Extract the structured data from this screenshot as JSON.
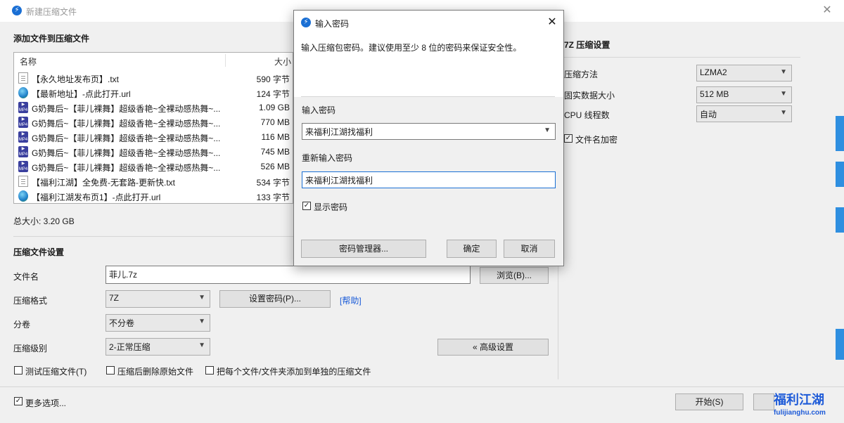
{
  "main": {
    "title": "新建压缩文件",
    "add_files_heading": "添加文件到压缩文件",
    "columns": {
      "name": "名称",
      "size": "大小"
    },
    "files": [
      {
        "name": "【永久地址发布页】.txt",
        "size": "590 字节",
        "icon": "txt-file-icon"
      },
      {
        "name": "【最新地址】-点此打开.url",
        "size": "124 字节",
        "icon": "url-file-icon"
      },
      {
        "name": "G奶舞后~【菲儿裸舞】超级香艳~全裸动感热舞~...",
        "size": "1.09 GB",
        "icon": "mp4-file-icon"
      },
      {
        "name": "G奶舞后~【菲儿裸舞】超级香艳~全裸动感热舞~...",
        "size": "770 MB",
        "icon": "mp4-file-icon"
      },
      {
        "name": "G奶舞后~【菲儿裸舞】超级香艳~全裸动感热舞~...",
        "size": "116 MB",
        "icon": "mp4-file-icon"
      },
      {
        "name": "G奶舞后~【菲儿裸舞】超级香艳~全裸动感热舞~...",
        "size": "745 MB",
        "icon": "mp4-file-icon"
      },
      {
        "name": "G奶舞后~【菲儿裸舞】超级香艳~全裸动感热舞~...",
        "size": "526 MB",
        "icon": "mp4-file-icon"
      },
      {
        "name": "【福利江湖】全免费-无套路-更新快.txt",
        "size": "534 字节",
        "icon": "txt-file-icon"
      },
      {
        "name": "【福利江湖发布页1】-点此打开.url",
        "size": "133 字节",
        "icon": "url-file-icon"
      }
    ],
    "total_size": "总大小: 3.20 GB",
    "settings_heading": "压缩文件设置",
    "filename_label": "文件名",
    "filename_value": "菲儿.7z",
    "browse_button": "浏览(B)...",
    "format_label": "压缩格式",
    "format_value": "7Z",
    "set_password_button": "设置密码(P)...",
    "help_link": "[帮助]",
    "split_label": "分卷",
    "split_value": "不分卷",
    "level_label": "压缩级别",
    "level_value": "2-正常压缩",
    "advanced_button": "« 高级设置",
    "test_checkbox": "测试压缩文件(T)",
    "delete_checkbox": "压缩后删除原始文件",
    "separate_checkbox": "把每个文件/文件夹添加到单独的压缩文件",
    "more_options": "更多选项...",
    "start_button": "开始(S)"
  },
  "right_panel": {
    "heading": "7Z 压缩设置",
    "method_label": "压缩方法",
    "method_value": "LZMA2",
    "solid_label": "固实数据大小",
    "solid_value": "512 MB",
    "threads_label": "CPU 线程数",
    "threads_value": "自动",
    "encrypt_names": "文件名加密"
  },
  "dialog": {
    "title": "输入密码",
    "instruction": "输入压缩包密码。建议使用至少 8 位的密码来保证安全性。",
    "password_label": "输入密码",
    "password_value": "来福利江湖找福利",
    "repeat_label": "重新输入密码",
    "repeat_value": "来福利江湖找福利",
    "show_password": "显示密码",
    "manager_button": "密码管理器...",
    "ok_button": "确定",
    "cancel_button": "取消"
  },
  "watermark": {
    "text": "福利江湖",
    "url": "fulijianghu.com"
  },
  "colors": {
    "accent": "#1a6fd4",
    "side_tab": "#2f8fe0",
    "watermark_blue": "#1e5bd8",
    "watermark_red": "#e02020"
  }
}
